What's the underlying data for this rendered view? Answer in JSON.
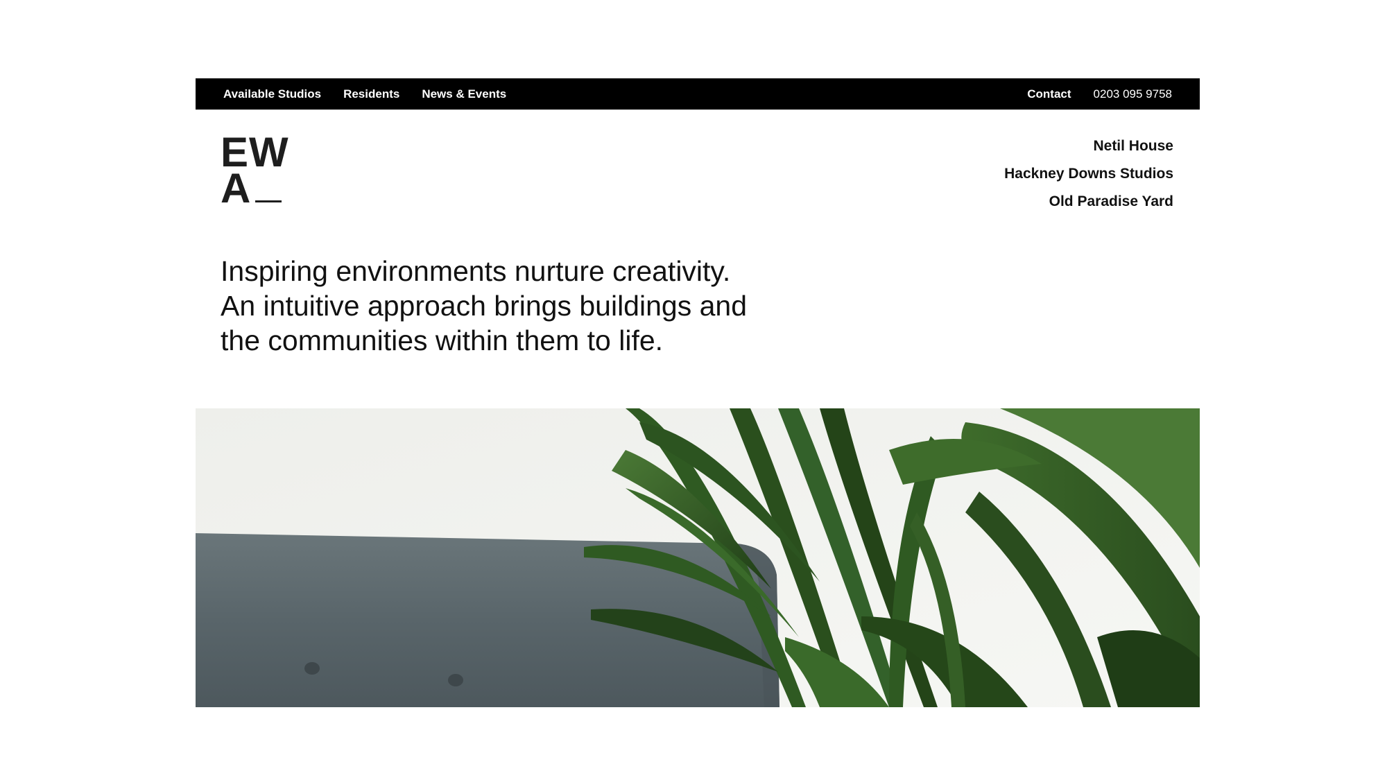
{
  "nav": {
    "left": [
      {
        "label": "Available Studios"
      },
      {
        "label": "Residents"
      },
      {
        "label": "News & Events"
      }
    ],
    "contact_label": "Contact",
    "phone": "0203 095 9758"
  },
  "logo": {
    "line1": "EW",
    "line2": "A"
  },
  "studios": [
    {
      "label": "Netil House"
    },
    {
      "label": "Hackney Downs Studios"
    },
    {
      "label": "Old Paradise Yard"
    }
  ],
  "intro": {
    "line1": "Inspiring environments nurture creativity.",
    "line2": "An intuitive approach brings buildings and",
    "line3": "the communities within them to life."
  },
  "colors": {
    "topbar": "#000000",
    "text": "#111111",
    "wall": "#ecedea",
    "sofa": "#59656a",
    "leaf": "#2f5a22"
  }
}
